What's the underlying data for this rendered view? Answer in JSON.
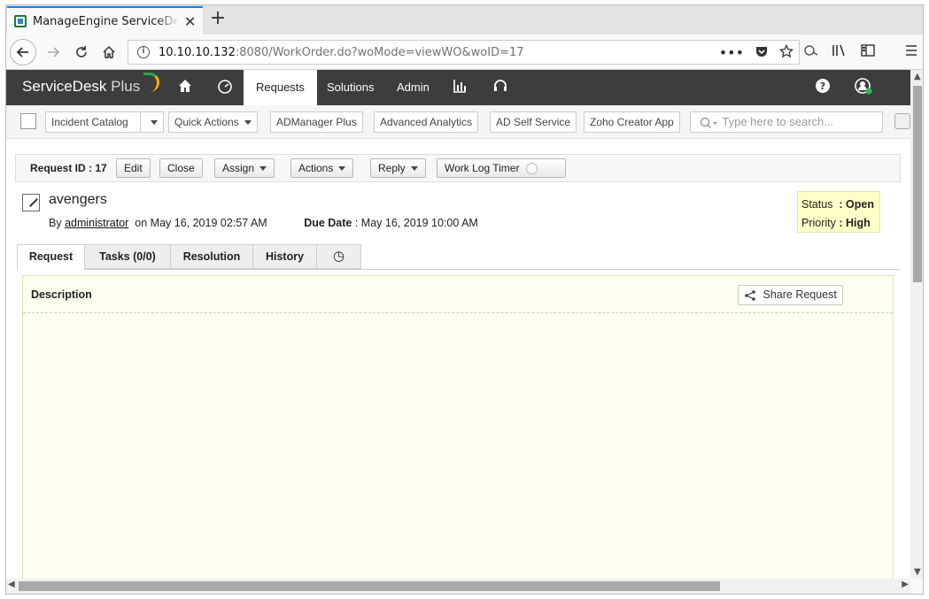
{
  "browser": {
    "tab_title": "ManageEngine ServiceDesk Plus",
    "tab_close": "✕",
    "new_tab": "+",
    "url_host": "10.10.10.132",
    "url_rest": ":8080/WorkOrder.do?woMode=viewWO&woID=17",
    "url_more": "•••",
    "icons": [
      "back-icon",
      "forward-icon",
      "reload-icon",
      "home-icon",
      "info-icon",
      "pocket-icon",
      "star-icon",
      "extension-icon",
      "library-icon",
      "sidebar-icon",
      "menu-icon"
    ]
  },
  "app": {
    "logo_main": "ServiceDesk",
    "logo_plus": " Plus",
    "nav_tabs": [
      "Requests",
      "Solutions",
      "Admin"
    ],
    "active_tab": "Requests"
  },
  "quickbar": {
    "incident_catalog": "Incident Catalog",
    "quick_actions": "Quick Actions",
    "admanager": "ADManager Plus",
    "analytics": "Advanced Analytics",
    "ad_self_service": "AD Self Service",
    "zoho_creator": "Zoho Creator App",
    "search_placeholder": "Type here to search..."
  },
  "request": {
    "id_label": "Request ID : 17",
    "buttons": {
      "edit": "Edit",
      "close": "Close",
      "assign": "Assign",
      "actions": "Actions",
      "reply": "Reply",
      "work_log_timer": "Work Log Timer"
    },
    "subject": "avengers",
    "by_label": "By",
    "by_user": "administrator",
    "on_label": "on",
    "created": "May 16, 2019 02:57 AM",
    "due_label": "Due Date",
    "due_value": ": May 16, 2019 10:00 AM",
    "status_label": "Status",
    "status_value": ": Open",
    "priority_label": "Priority",
    "priority_value": ": High"
  },
  "detail_tabs": {
    "request": "Request",
    "tasks": "Tasks (0/0)",
    "resolution": "Resolution",
    "history": "History",
    "clock": "◷"
  },
  "description": {
    "title": "Description",
    "share": "Share Request"
  },
  "colors": {
    "header_bg": "#3d3d3d",
    "status_bg": "#ffffc8",
    "desc_bg": "#fffff0"
  }
}
